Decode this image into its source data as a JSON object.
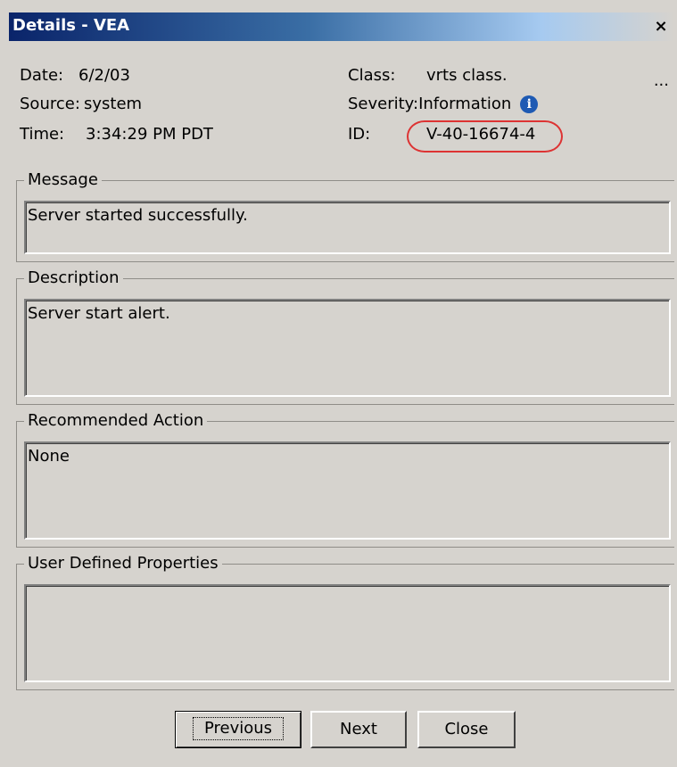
{
  "window": {
    "title": "Details - VEA",
    "close_glyph": "×"
  },
  "info": {
    "date_label": "Date:",
    "date_value": "6/2/03",
    "source_label": "Source:",
    "source_value": "system",
    "time_label": "Time:",
    "time_value": "3:34:29 PM PDT",
    "class_label": "Class:",
    "class_value": "vrts class.",
    "severity_label": "Severity:",
    "severity_value": "Information",
    "id_label": "ID:",
    "id_value": "V-40-16674-4",
    "more": "..."
  },
  "severity_icon": "info-icon",
  "sections": {
    "message": {
      "legend": "Message",
      "text": "Server started successfully."
    },
    "description": {
      "legend": "Description",
      "text": "Server start alert."
    },
    "recommended": {
      "legend": "Recommended Action",
      "text": "None"
    },
    "user_defined": {
      "legend": "User Defined Properties",
      "text": ""
    }
  },
  "buttons": {
    "previous": "Previous",
    "next": "Next",
    "close": "Close"
  },
  "colors": {
    "titlebar_start": "#0a246a",
    "highlight_ellipse": "#dd3333",
    "info_icon": "#1e5ab3"
  }
}
